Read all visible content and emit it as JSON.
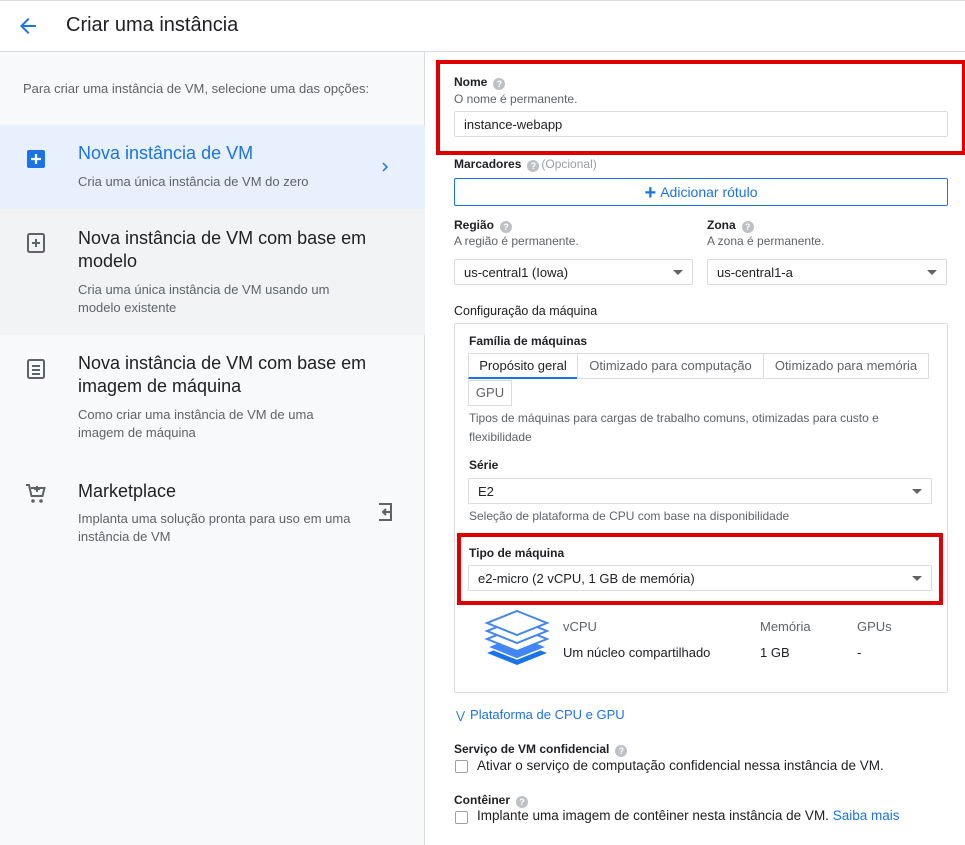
{
  "header": {
    "title": "Criar uma instância"
  },
  "left": {
    "intro": "Para criar uma instância de VM, selecione uma das opções:",
    "options": [
      {
        "title": "Nova instância de VM",
        "desc": "Cria uma única instância de VM do zero"
      },
      {
        "title": "Nova instância de VM com base em modelo",
        "desc": "Cria uma única instância de VM usando um modelo existente"
      },
      {
        "title": "Nova instância de VM com base em imagem de máquina",
        "desc": "Como criar uma instância de VM de uma imagem de máquina"
      },
      {
        "title": "Marketplace",
        "desc": "Implanta uma solução pronta para uso em uma instância de VM"
      }
    ]
  },
  "form": {
    "name": {
      "label": "Nome",
      "hint": "O nome é permanente.",
      "value": "instance-webapp"
    },
    "labels": {
      "label": "Marcadores",
      "optional": "(Opcional)",
      "add_button": "Adicionar rótulo"
    },
    "region": {
      "label": "Região",
      "hint": "A região é permanente.",
      "value": "us-central1 (Iowa)"
    },
    "zone": {
      "label": "Zona",
      "hint": "A zona é permanente.",
      "value": "us-central1-a"
    },
    "machine_config": {
      "label": "Configuração da máquina",
      "family_label": "Família de máquinas",
      "tabs": [
        "Propósito geral",
        "Otimizado para computação",
        "Otimizado para memória",
        "GPU"
      ],
      "family_desc": "Tipos de máquinas para cargas de trabalho comuns, otimizadas para custo e flexibilidade",
      "series_label": "Série",
      "series_value": "E2",
      "series_hint": "Seleção de plataforma de CPU com base na disponibilidade",
      "type_label": "Tipo de máquina",
      "type_value": "e2-micro (2 vCPU, 1 GB de memória)",
      "specs": {
        "vcpu_label": "vCPU",
        "vcpu_value": "Um núcleo compartilhado",
        "mem_label": "Memória",
        "mem_value": "1 GB",
        "gpu_label": "GPUs",
        "gpu_value": "-"
      }
    },
    "cpu_platform_link": "Plataforma de CPU e GPU",
    "confidential": {
      "label": "Serviço de VM confidencial",
      "checkbox": "Ativar o serviço de computação confidencial nessa instância de VM."
    },
    "container": {
      "label": "Contêiner",
      "checkbox": "Implante uma imagem de contêiner nesta instância de VM.",
      "link": "Saiba mais"
    }
  },
  "colors": {
    "accent": "#1a73e8",
    "highlight": "#e00000",
    "selected_bg": "#e8f0fe"
  }
}
